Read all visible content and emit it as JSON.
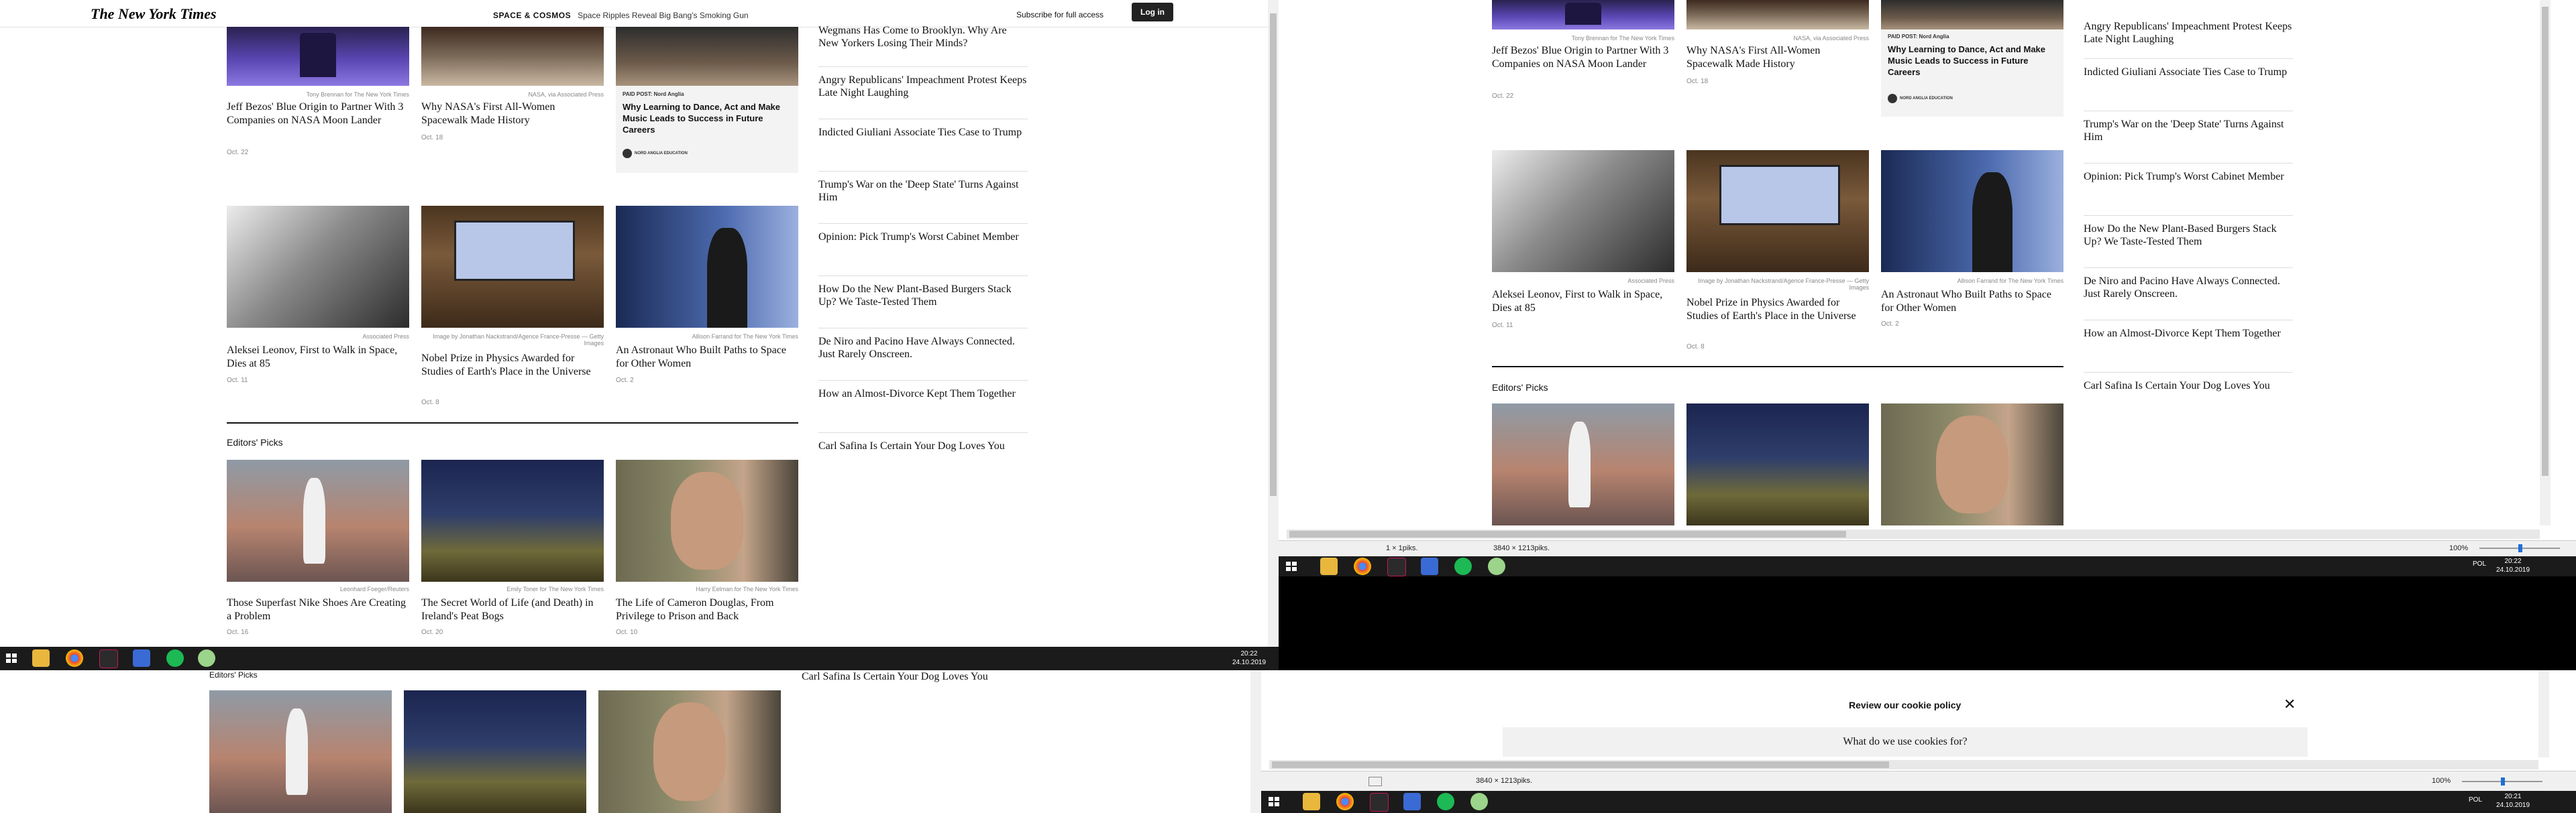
{
  "nyt": {
    "logo": "The New York Times",
    "section_label": "SPACE & COSMOS",
    "section_headline": "Space Ripples Reveal Big Bang's Smoking Gun",
    "subscribe": "Subscribe for full access",
    "login": "Log in"
  },
  "grid_row1": [
    {
      "credit": "Tony Brennan for The New York Times",
      "headline": "Jeff Bezos' Blue Origin to Partner With 3 Companies on NASA Moon Lander",
      "date": "Oct. 22"
    },
    {
      "credit": "NASA, via Associated Press",
      "headline": "Why NASA's First All-Women Spacewalk Made History",
      "date": "Oct. 18"
    }
  ],
  "paid_post": {
    "label": "PAID POST: Nord Anglia",
    "title": "Why Learning to Dance, Act and Make Music Leads to Success in Future Careers",
    "brand": "NORD ANGLIA EDUCATION"
  },
  "grid_row2": [
    {
      "credit": "Associated Press",
      "headline": "Aleksei Leonov, First to Walk in Space, Dies at 85",
      "date": "Oct. 11"
    },
    {
      "credit": "Image by Jonathan Nackstrand/Agence France-Presse — Getty Images",
      "headline": "Nobel Prize in Physics Awarded for Studies of Earth's Place in the Universe",
      "date": "Oct. 8"
    },
    {
      "credit": "Allison Farrand for The New York Times",
      "headline": "An Astronaut Who Built Paths to Space for Other Women",
      "date": "Oct. 2"
    }
  ],
  "editors_picks": {
    "title": "Editors' Picks",
    "items": [
      {
        "credit": "Leonhard Foeger/Reuters",
        "headline": "Those Superfast Nike Shoes Are Creating a Problem",
        "date": "Oct. 16"
      },
      {
        "credit": "Emily Toner for The New York Times",
        "headline": "The Secret World of Life (and Death) in Ireland's Peat Bogs",
        "date": "Oct. 20"
      },
      {
        "credit": "Harry Eelman for The New York Times",
        "headline": "The Life of Cameron Douglas, From Privilege to Prison and Back",
        "date": "Oct. 10"
      }
    ]
  },
  "most_popular": [
    "Wegmans Has Come to Brooklyn. Why Are New Yorkers Losing Their Minds?",
    "Angry Republicans' Impeachment Protest Keeps Late Night Laughing",
    "Indicted Giuliani Associate Ties Case to Trump",
    "Trump's War on the 'Deep State' Turns Against Him",
    "Opinion: Pick Trump's Worst Cabinet Member",
    "How Do the New Plant-Based Burgers Stack Up? We Taste-Tested Them",
    "De Niro and Pacino Have Always Connected. Just Rarely Onscreen.",
    "How an Almost-Divorce Kept Them Together",
    "Carl Safina Is Certain Your Dog Loves You"
  ],
  "taskbar_left": {
    "time": "20:22",
    "date": "24.10.2019"
  },
  "viewer_top": {
    "status_position": "1 × 1piks.",
    "status_size": "3840 × 1213piks.",
    "zoom": "100%",
    "lang": "POL",
    "time": "20:22",
    "date": "24.10.2019"
  },
  "viewer_bottom": {
    "cookie_title": "Review our cookie policy",
    "cookie_question": "What do we use cookies for?",
    "status_size": "3840 × 1213piks.",
    "zoom": "100%",
    "lang": "POL",
    "time": "20:21",
    "date": "24.10.2019"
  },
  "icons": [
    "windows-start-icon",
    "file-explorer-icon",
    "chrome-icon",
    "terminal-icon",
    "mail-icon",
    "spotify-icon",
    "settings-icon",
    "close-icon"
  ]
}
